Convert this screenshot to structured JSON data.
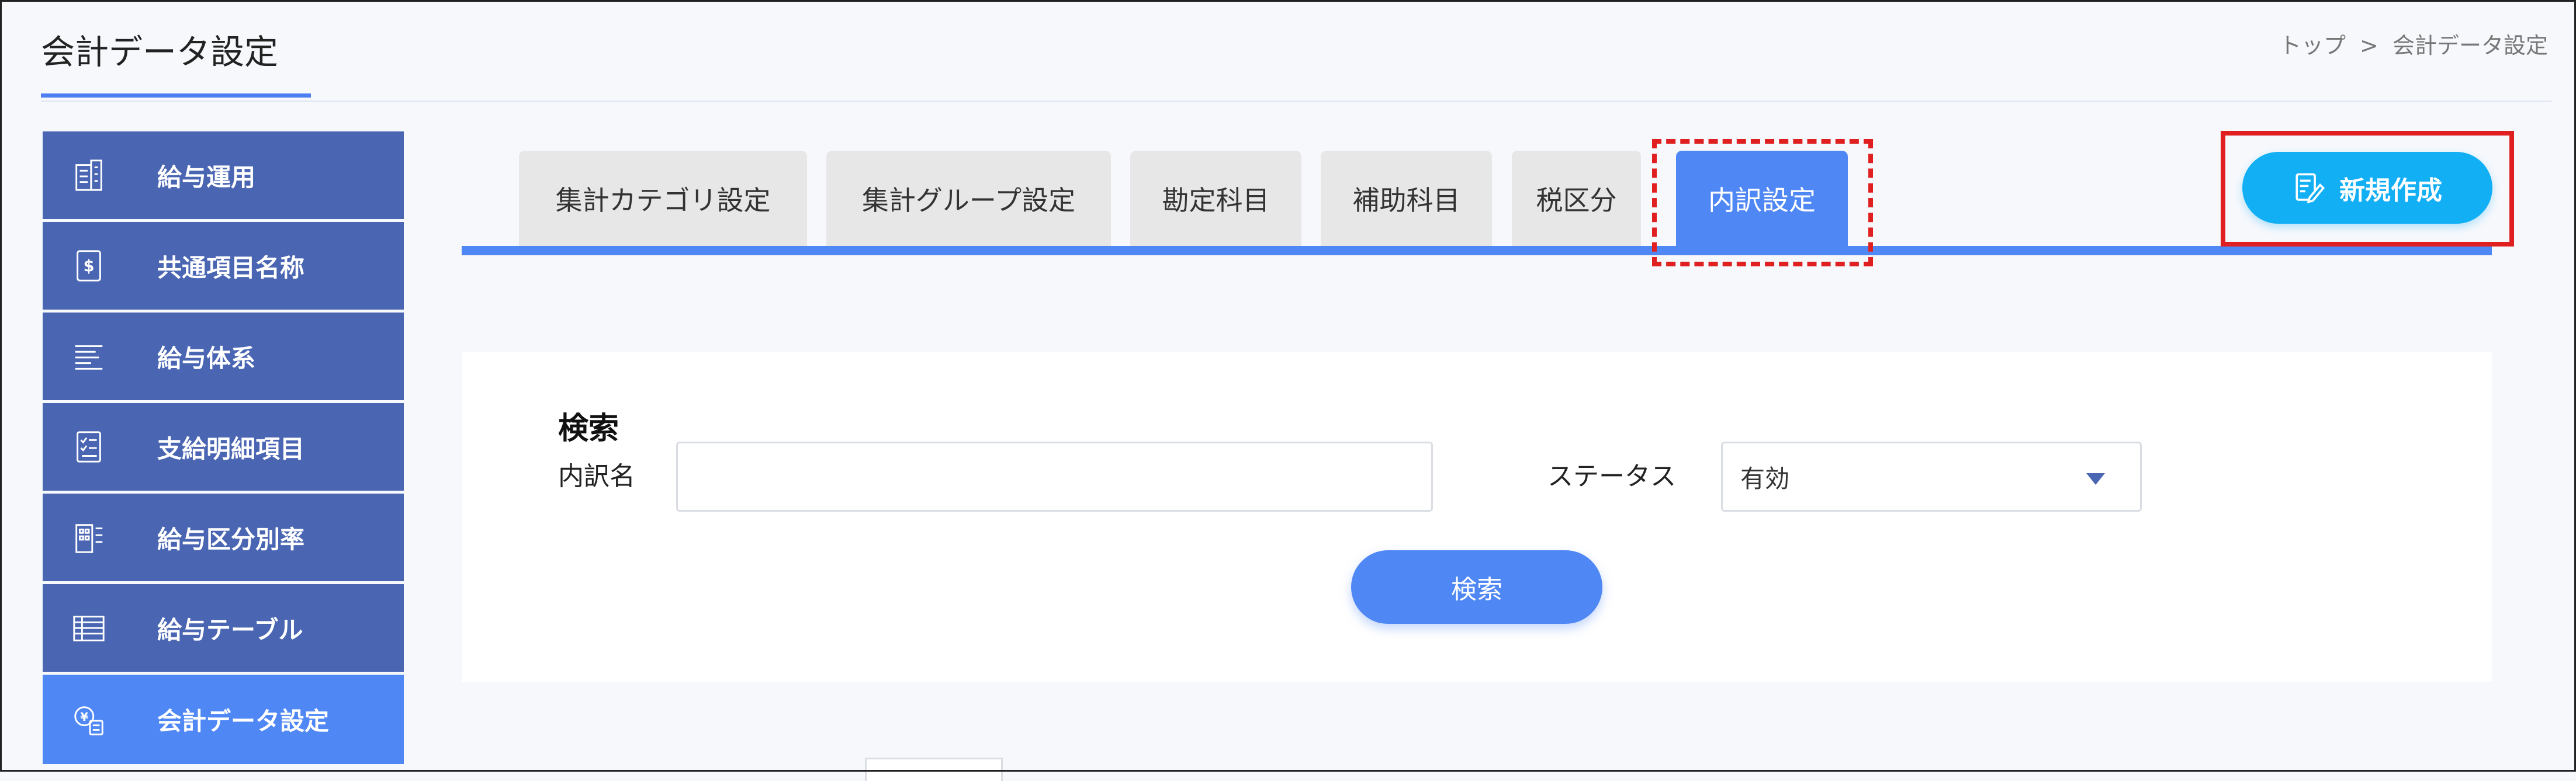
{
  "header": {
    "title": "会計データ設定",
    "breadcrumb": [
      "トップ",
      ">",
      "会計データ設定"
    ]
  },
  "sidebar": {
    "items": [
      {
        "label": "給与運用",
        "icon": "building-icon"
      },
      {
        "label": "共通項目名称",
        "icon": "dollar-document-icon"
      },
      {
        "label": "給与体系",
        "icon": "pay-structure-icon"
      },
      {
        "label": "支給明細項目",
        "icon": "checklist-icon"
      },
      {
        "label": "給与区分別率",
        "icon": "rate-building-icon"
      },
      {
        "label": "給与テーブル",
        "icon": "table-icon"
      },
      {
        "label": "会計データ設定",
        "icon": "accounting-data-icon",
        "active": true
      }
    ]
  },
  "tabs": [
    {
      "label": "集計カテゴリ設定"
    },
    {
      "label": "集計グループ設定"
    },
    {
      "label": "勘定科目"
    },
    {
      "label": "補助科目"
    },
    {
      "label": "税区分"
    },
    {
      "label": "内訳設定",
      "active": true
    }
  ],
  "actions": {
    "new_label": "新規作成",
    "new_icon": "edit-document-icon"
  },
  "search": {
    "title": "検索",
    "name_label": "内訳名",
    "name_value": "",
    "status_label": "ステータス",
    "status_value": "有効",
    "button_label": "検索"
  },
  "colors": {
    "sidebar": "#4a66b3",
    "active": "#4f87f4",
    "new_button": "#13aff5",
    "highlight": "#e02020"
  }
}
